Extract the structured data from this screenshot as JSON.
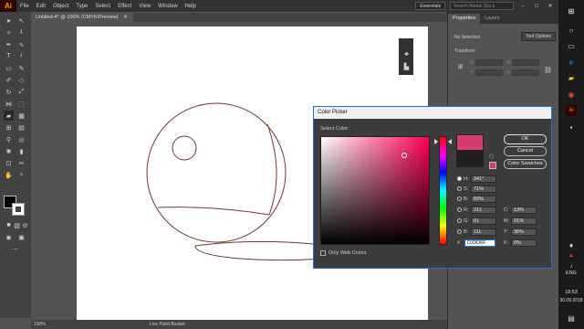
{
  "app": {
    "logo": "Ai",
    "menu": [
      "File",
      "Edit",
      "Object",
      "Type",
      "Select",
      "Effect",
      "View",
      "Window",
      "Help"
    ],
    "workspace": "Essentials",
    "search_placeholder": "Search Adobe Stock"
  },
  "document": {
    "tab_title": "Untitled-4* @ 100% (CMYK/Preview)",
    "zoom": "100%",
    "status_tool": "Live Paint Bucket"
  },
  "right_panel": {
    "tabs": [
      "Properties",
      "Layers"
    ],
    "selection": "No Selection",
    "tool_options": "Tool Options",
    "transform_title": "Transform",
    "fields": [
      "X:",
      "Y:",
      "W:",
      "H:"
    ]
  },
  "dialog": {
    "title": "Color Picker",
    "select_label": "Select Color:",
    "ok": "OK",
    "cancel": "Cancel",
    "swatches": "Color Swatches",
    "hsb": [
      {
        "label": "H:",
        "value": "341°",
        "selected": true
      },
      {
        "label": "S:",
        "value": "71%",
        "selected": false
      },
      {
        "label": "B:",
        "value": "83%",
        "selected": false
      }
    ],
    "rgb": [
      {
        "label": "R:",
        "value": "211"
      },
      {
        "label": "G:",
        "value": "61"
      },
      {
        "label": "B:",
        "value": "111"
      }
    ],
    "cmyk": [
      {
        "label": "C:",
        "value": "13%"
      },
      {
        "label": "M:",
        "value": "91%"
      },
      {
        "label": "Y:",
        "value": "36%"
      },
      {
        "label": "K:",
        "value": "0%"
      }
    ],
    "hex_label": "#",
    "hex": "D33D6F",
    "new_color": "#d33d6f",
    "web_colors_label": "Only Web Colors"
  },
  "taskbar": {
    "language": "ENG",
    "time": "18:53",
    "date": "30.09.2018"
  }
}
